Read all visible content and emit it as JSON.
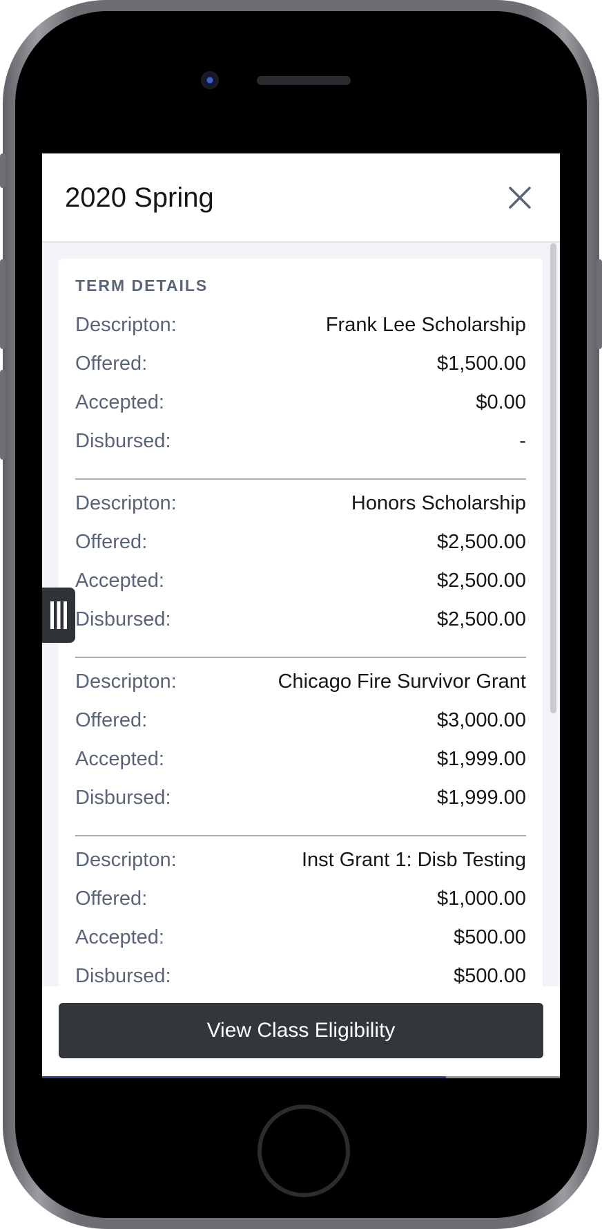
{
  "modal": {
    "title": "2020 Spring",
    "close_icon": "close-icon"
  },
  "section": {
    "title": "TERM DETAILS"
  },
  "awards": [
    {
      "desc_label": "Descripton:",
      "desc": "Frank Lee Scholarship",
      "offered_label": "Offered:",
      "offered": "$1,500.00",
      "accepted_label": "Accepted:",
      "accepted": "$0.00",
      "disbursed_label": "Disbursed:",
      "disbursed": "-"
    },
    {
      "desc_label": "Descripton:",
      "desc": "Honors Scholarship",
      "offered_label": "Offered:",
      "offered": "$2,500.00",
      "accepted_label": "Accepted:",
      "accepted": "$2,500.00",
      "disbursed_label": "Disbursed:",
      "disbursed": "$2,500.00"
    },
    {
      "desc_label": "Descripton:",
      "desc": "Chicago Fire Survivor Grant",
      "offered_label": "Offered:",
      "offered": "$3,000.00",
      "accepted_label": "Accepted:",
      "accepted": "$1,999.00",
      "disbursed_label": "Disbursed:",
      "disbursed": "$1,999.00"
    },
    {
      "desc_label": "Descripton:",
      "desc": "Inst Grant 1: Disb Testing",
      "offered_label": "Offered:",
      "offered": "$1,000.00",
      "accepted_label": "Accepted:",
      "accepted": "$500.00",
      "disbursed_label": "Disbursed:",
      "disbursed": "$500.00"
    }
  ],
  "footer": {
    "button_label": "View Class Eligibility"
  },
  "page_progress": 0.78,
  "drawer_handle_icon": "drawer-handle-icon",
  "colors": {
    "header_text": "#161616",
    "label_text": "#5a6478",
    "button_bg": "#33363b",
    "progress": "#1f3f8a"
  }
}
